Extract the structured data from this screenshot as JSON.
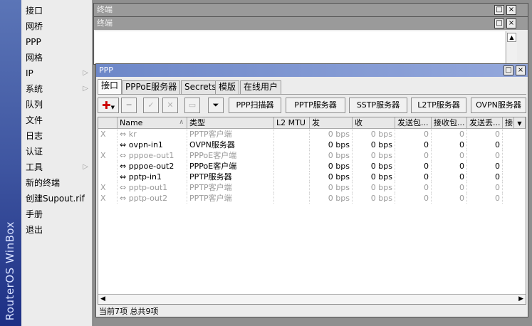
{
  "sidebar": {
    "brand": "RouterOS WinBox",
    "items": [
      {
        "label": "接口"
      },
      {
        "label": "网桥"
      },
      {
        "label": "PPP"
      },
      {
        "label": "网格"
      },
      {
        "label": "IP",
        "submenu": true
      },
      {
        "label": "系统",
        "submenu": true
      },
      {
        "label": "队列"
      },
      {
        "label": "文件"
      },
      {
        "label": "日志"
      },
      {
        "label": "认证"
      },
      {
        "label": "工具",
        "submenu": true
      },
      {
        "label": "新的终端"
      },
      {
        "label": "创建Supout.rif"
      },
      {
        "label": "手册"
      },
      {
        "label": "退出"
      }
    ]
  },
  "terminal1": {
    "title": "终端"
  },
  "terminal2": {
    "title": "终端"
  },
  "ppp": {
    "title": "PPP",
    "tabs": [
      "接口",
      "PPPoE服务器",
      "Secrets",
      "模版",
      "在线用户"
    ],
    "toolbar": {
      "ppp_scanner": "PPP扫描器",
      "pptp_server": "PPTP服务器",
      "sstp_server": "SSTP服务器",
      "l2tp_server": "L2TP服务器",
      "ovpn_server": "OVPN服务器"
    },
    "columns": [
      "",
      "Name",
      "类型",
      "L2 MTU",
      "发",
      "收",
      "发送包...",
      "接收包...",
      "发送丢...",
      "接收"
    ],
    "rows": [
      {
        "flag": "X",
        "name": "kr",
        "type": "PPTP客户端",
        "mtu": "",
        "tx": "0 bps",
        "rx": "0 bps",
        "txp": "0",
        "rxp": "0",
        "txd": "0",
        "disabled": true
      },
      {
        "flag": "",
        "name": "ovpn-in1",
        "type": "OVPN服务器",
        "mtu": "",
        "tx": "0 bps",
        "rx": "0 bps",
        "txp": "0",
        "rxp": "0",
        "txd": "0",
        "disabled": false
      },
      {
        "flag": "X",
        "name": "pppoe-out1",
        "type": "PPPoE客户端",
        "mtu": "",
        "tx": "0 bps",
        "rx": "0 bps",
        "txp": "0",
        "rxp": "0",
        "txd": "0",
        "disabled": true
      },
      {
        "flag": "",
        "name": "pppoe-out2",
        "type": "PPPoE客户端",
        "mtu": "",
        "tx": "0 bps",
        "rx": "0 bps",
        "txp": "0",
        "rxp": "0",
        "txd": "0",
        "disabled": false
      },
      {
        "flag": "",
        "name": "pptp-in1",
        "type": "PPTP服务器",
        "mtu": "",
        "tx": "0 bps",
        "rx": "0 bps",
        "txp": "0",
        "rxp": "0",
        "txd": "0",
        "disabled": false
      },
      {
        "flag": "X",
        "name": "pptp-out1",
        "type": "PPTP客户端",
        "mtu": "",
        "tx": "0 bps",
        "rx": "0 bps",
        "txp": "0",
        "rxp": "0",
        "txd": "0",
        "disabled": true
      },
      {
        "flag": "X",
        "name": "pptp-out2",
        "type": "PPTP客户端",
        "mtu": "",
        "tx": "0 bps",
        "rx": "0 bps",
        "txp": "0",
        "rxp": "0",
        "txd": "0",
        "disabled": true
      }
    ],
    "status": "当前7项 总共9项"
  },
  "colors": {
    "active_title": "#6d87c8",
    "inactive_title": "#9a9a9a",
    "add_icon": "#cc0000",
    "sidebar_dark": "#1d2f84"
  }
}
